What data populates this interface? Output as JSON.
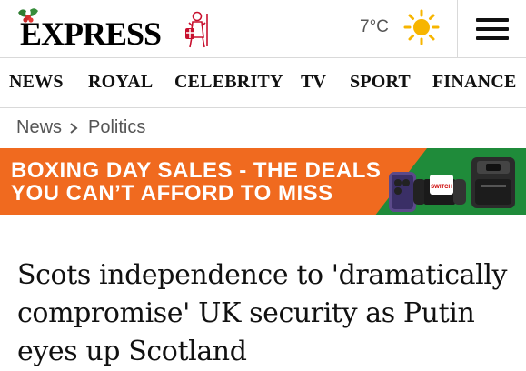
{
  "header": {
    "logo_text": "EXPRESS",
    "weather": {
      "temperature": "7°C",
      "icon": "sun-icon"
    },
    "menu_icon": "hamburger-menu-icon"
  },
  "nav": {
    "items": [
      "NEWS",
      "ROYAL",
      "CELEBRITY",
      "TV",
      "SPORT",
      "FINANCE"
    ]
  },
  "breadcrumb": {
    "items": [
      "News",
      "Politics"
    ]
  },
  "banner": {
    "line1": "BOXING DAY SALES - THE DEALS",
    "line2": "YOU CAN’T AFFORD TO MISS",
    "colors": {
      "orange": "#f06a1f",
      "green": "#1f8b3a"
    }
  },
  "article": {
    "headline": "Scots independence to 'dramatically compromise' UK security as Putin eyes up Scotland"
  },
  "colors": {
    "brand_red": "#c8102e",
    "sun": "#f7b500",
    "text": "#111111"
  }
}
